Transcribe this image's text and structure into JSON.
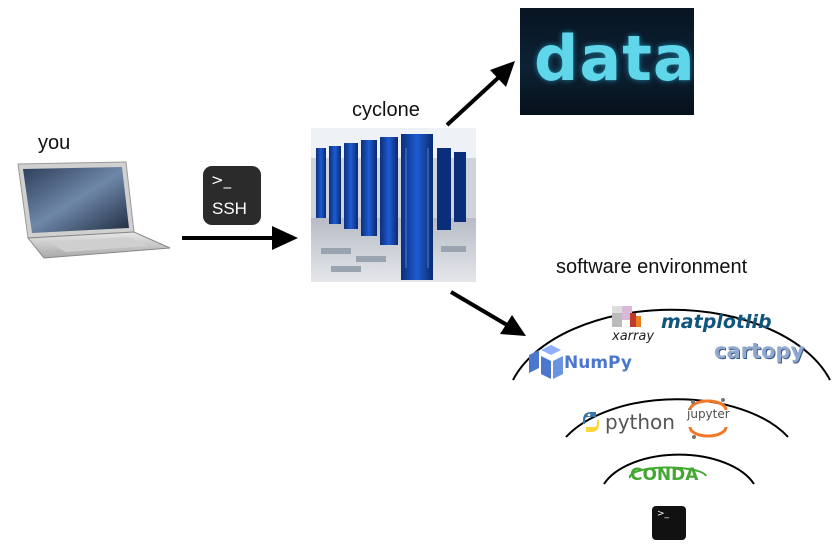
{
  "labels": {
    "you": "you",
    "cyclone": "cyclone",
    "software_env": "software environment"
  },
  "ssh_icon": {
    "prompt": ">_",
    "text": "SSH"
  },
  "data_image": {
    "text": "data"
  },
  "logos": {
    "xarray": "xarray",
    "matplotlib": "matplotlib",
    "cartopy": "cartopy",
    "numpy": "NumPy",
    "python": "python",
    "jupyter": "jupyter",
    "conda": "CONDA",
    "terminal_prompt": ">_"
  },
  "colors": {
    "arrow": "#000000",
    "numpy": "#4d77cf",
    "matplotlib": "#11557c",
    "conda": "#44a833",
    "jupyter": "#f37726",
    "data_cyan": "#5fd6e9"
  }
}
